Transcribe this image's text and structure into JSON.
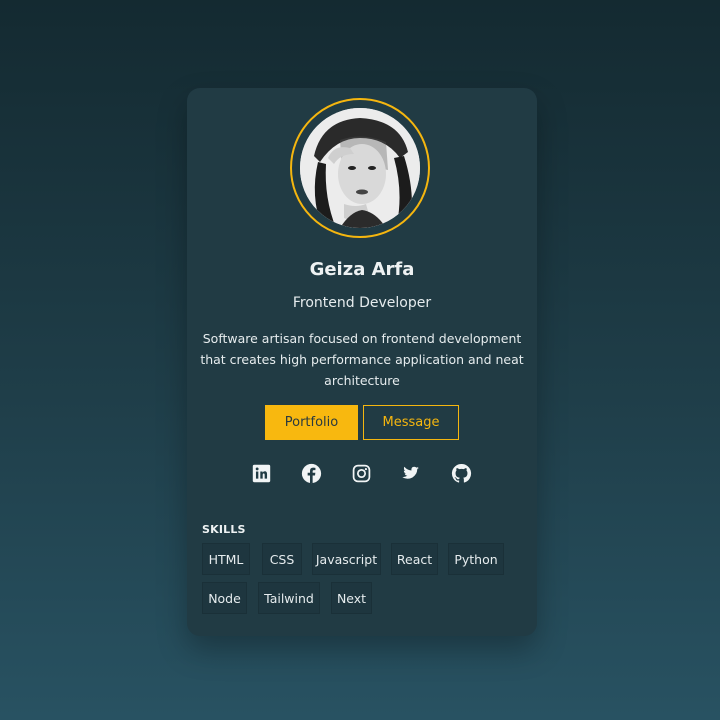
{
  "profile": {
    "name": "Geiza Arfa",
    "role": "Frontend Developer",
    "bio": "Software artisan focused on frontend development that creates high performance application and neat architecture",
    "avatar_alt": "Profile photo"
  },
  "actions": {
    "portfolio_label": "Portfolio",
    "message_label": "Message"
  },
  "socials": [
    {
      "icon": "linkedin-icon"
    },
    {
      "icon": "facebook-icon"
    },
    {
      "icon": "instagram-icon"
    },
    {
      "icon": "twitter-icon"
    },
    {
      "icon": "github-icon"
    }
  ],
  "skills": {
    "title": "SKILLS",
    "items": [
      "HTML",
      "CSS",
      "Javascript",
      "React",
      "Python",
      "Node",
      "Tailwind",
      "Next"
    ]
  },
  "colors": {
    "accent": "#f5b60f",
    "card": "#213b44",
    "chip": "#1e363f",
    "text": "#eef2f3"
  }
}
